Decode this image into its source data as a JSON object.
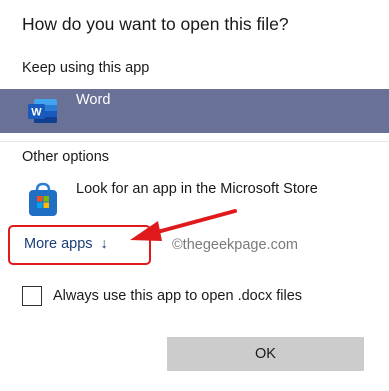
{
  "dialog": {
    "title": "How do you want to open this file?",
    "keep_using_label": "Keep using this app",
    "current_app": {
      "name": "Word",
      "icon": "word-icon",
      "selected": true
    },
    "other_options_label": "Other options",
    "other_apps": [
      {
        "name": "Look for an app in the Microsoft Store",
        "icon": "microsoft-store-icon"
      }
    ],
    "more_apps_label": "More apps",
    "more_apps_arrow": "↓",
    "checkbox": {
      "label": "Always use this app to open .docx files",
      "checked": false
    },
    "ok_label": "OK"
  },
  "annotation": {
    "watermark": "©thegeekpage.com",
    "highlight_color": "#e0191c"
  },
  "colors": {
    "selected_row": "#6a7197",
    "link": "#1a3e74",
    "button": "#cccccc"
  }
}
